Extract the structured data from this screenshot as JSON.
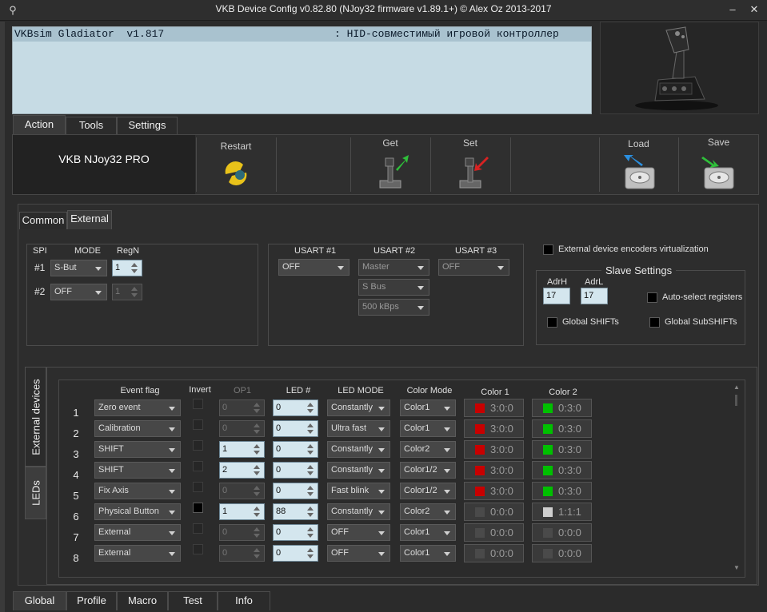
{
  "window": {
    "title": "VKB Device Config v0.82.80 (NJoy32 firmware v1.89.1+) © Alex Oz 2013-2017",
    "minimize_glyph": "–",
    "close_glyph": "✕"
  },
  "info": {
    "device_name": "VKBsim Gladiator  v1.817",
    "device_desc": ": HID-совместимый игровой контроллер"
  },
  "top_tabs": [
    "Action",
    "Tools",
    "Settings"
  ],
  "toolbar": {
    "product": "VKB NJoy32 PRO",
    "restart": "Restart",
    "get": "Get",
    "set": "Set",
    "load": "Load",
    "save": "Save"
  },
  "sub_tabs": [
    "Common",
    "External"
  ],
  "spi": {
    "header_spi": "SPI",
    "header_mode": "MODE",
    "header_regn": "RegN",
    "rows": [
      {
        "num": "#1",
        "mode": "S-But",
        "regn": "1"
      },
      {
        "num": "#2",
        "mode": "OFF",
        "regn": "1"
      }
    ]
  },
  "usart": {
    "h1": "USART #1",
    "h2": "USART #2",
    "h3": "USART #3",
    "u1": "OFF",
    "u2": "Master",
    "u2_bus": "S Bus",
    "u2_speed": "500 kBps",
    "u3": "OFF"
  },
  "ext_encoders": "External device encoders virtualization",
  "slave": {
    "title": "Slave Settings",
    "adrh_label": "AdrH",
    "adrl_label": "AdrL",
    "adrh": "17",
    "adrl": "17",
    "auto_select": "Auto-select registers",
    "global_shifts": "Global SHIFTs",
    "global_subshifts": "Global SubSHIFTs"
  },
  "vertical_tabs": [
    "External devices",
    "LEDs"
  ],
  "leds": {
    "headers": {
      "event": "Event flag",
      "invert": "Invert",
      "op1": "OP1",
      "led": "LED #",
      "mode": "LED MODE",
      "color_mode": "Color Mode",
      "color1": "Color 1",
      "color2": "Color 2"
    },
    "rows": [
      {
        "n": "1",
        "event": "Zero event",
        "invert": false,
        "op1": "0",
        "op1_enabled": false,
        "led": "0",
        "mode": "Constantly",
        "cmode": "Color1",
        "c1": "3:0:0",
        "c1_color": "#c80000",
        "c2": "0:3:0",
        "c2_color": "#00c000"
      },
      {
        "n": "2",
        "event": "Calibration",
        "invert": false,
        "op1": "0",
        "op1_enabled": false,
        "led": "0",
        "mode": "Ultra fast",
        "cmode": "Color1",
        "c1": "3:0:0",
        "c1_color": "#c80000",
        "c2": "0:3:0",
        "c2_color": "#00c000"
      },
      {
        "n": "3",
        "event": "SHIFT",
        "invert": false,
        "op1": "1",
        "op1_enabled": true,
        "led": "0",
        "mode": "Constantly",
        "cmode": "Color2",
        "c1": "3:0:0",
        "c1_color": "#c80000",
        "c2": "0:3:0",
        "c2_color": "#00c000"
      },
      {
        "n": "4",
        "event": "SHIFT",
        "invert": false,
        "op1": "2",
        "op1_enabled": true,
        "led": "0",
        "mode": "Constantly",
        "cmode": "Color1/2",
        "c1": "3:0:0",
        "c1_color": "#c80000",
        "c2": "0:3:0",
        "c2_color": "#00c000"
      },
      {
        "n": "5",
        "event": "Fix Axis",
        "invert": false,
        "op1": "0",
        "op1_enabled": false,
        "led": "0",
        "mode": "Fast blink",
        "cmode": "Color1/2",
        "c1": "3:0:0",
        "c1_color": "#c80000",
        "c2": "0:3:0",
        "c2_color": "#00c000"
      },
      {
        "n": "6",
        "event": "Physical Button",
        "invert": true,
        "op1": "1",
        "op1_enabled": true,
        "led": "88",
        "mode": "Constantly",
        "cmode": "Color2",
        "c1": "0:0:0",
        "c1_color": "#4a4a4a",
        "c2": "1:1:1",
        "c2_color": "#cfcfcf"
      },
      {
        "n": "7",
        "event": "External",
        "invert": false,
        "op1": "0",
        "op1_enabled": false,
        "led": "0",
        "mode": "OFF",
        "cmode": "Color1",
        "c1": "0:0:0",
        "c1_color": "#4a4a4a",
        "c2": "0:0:0",
        "c2_color": "#4a4a4a"
      },
      {
        "n": "8",
        "event": "External",
        "invert": false,
        "op1": "0",
        "op1_enabled": false,
        "led": "0",
        "mode": "OFF",
        "cmode": "Color1",
        "c1": "0:0:0",
        "c1_color": "#4a4a4a",
        "c2": "0:0:0",
        "c2_color": "#4a4a4a"
      }
    ]
  },
  "bottom_tabs": [
    "Global",
    "Profile",
    "Macro",
    "Test",
    "Info"
  ]
}
